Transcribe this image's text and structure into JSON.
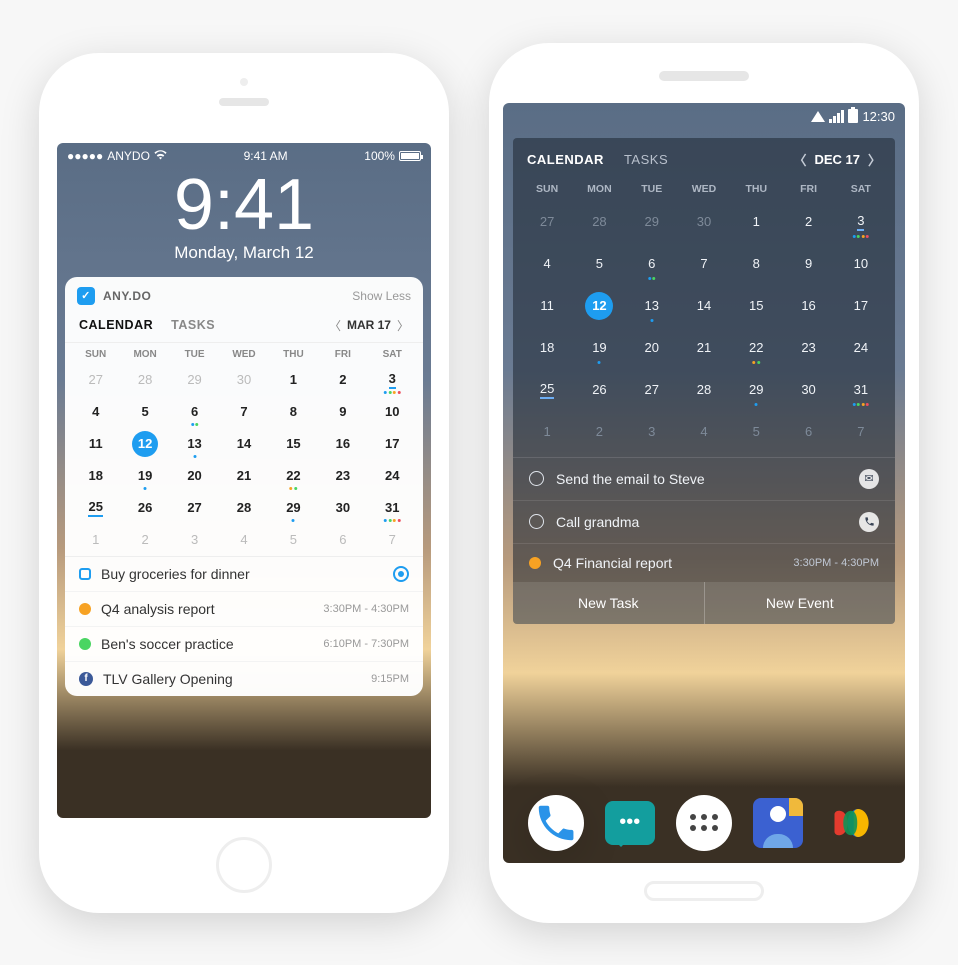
{
  "ios": {
    "status": {
      "carrier": "ANYDO",
      "time": "9:41 AM",
      "battery": "100%"
    },
    "lock": {
      "time": "9:41",
      "date": "Monday, March 12"
    },
    "widget": {
      "brand": "ANY.DO",
      "showless": "Show Less",
      "tabs": {
        "calendar": "CALENDAR",
        "tasks": "TASKS"
      },
      "nav_label": "MAR 17",
      "dow": [
        "SUN",
        "MON",
        "TUE",
        "WED",
        "THU",
        "FRI",
        "SAT"
      ],
      "weeks": [
        [
          {
            "n": "27",
            "fade": true
          },
          {
            "n": "28",
            "fade": true
          },
          {
            "n": "29",
            "fade": true
          },
          {
            "n": "30",
            "fade": true
          },
          {
            "n": "1"
          },
          {
            "n": "2"
          },
          {
            "n": "3",
            "ul": true,
            "dots": [
              "b",
              "g",
              "o",
              "r"
            ]
          }
        ],
        [
          {
            "n": "4"
          },
          {
            "n": "5"
          },
          {
            "n": "6",
            "dots": [
              "b",
              "g"
            ]
          },
          {
            "n": "7"
          },
          {
            "n": "8"
          },
          {
            "n": "9"
          },
          {
            "n": "10"
          }
        ],
        [
          {
            "n": "11"
          },
          {
            "n": "12",
            "sel": true
          },
          {
            "n": "13",
            "dots": [
              "b"
            ]
          },
          {
            "n": "14"
          },
          {
            "n": "15"
          },
          {
            "n": "16"
          },
          {
            "n": "17"
          }
        ],
        [
          {
            "n": "18"
          },
          {
            "n": "19",
            "dots": [
              "b"
            ]
          },
          {
            "n": "20"
          },
          {
            "n": "21"
          },
          {
            "n": "22",
            "dots": [
              "o",
              "g"
            ]
          },
          {
            "n": "23"
          },
          {
            "n": "24"
          }
        ],
        [
          {
            "n": "25",
            "ul": true
          },
          {
            "n": "26"
          },
          {
            "n": "27"
          },
          {
            "n": "28"
          },
          {
            "n": "29",
            "dots": [
              "b"
            ]
          },
          {
            "n": "30"
          },
          {
            "n": "31",
            "dots": [
              "b",
              "g",
              "o",
              "r"
            ]
          }
        ],
        [
          {
            "n": "1",
            "fade": true
          },
          {
            "n": "2",
            "fade": true
          },
          {
            "n": "3",
            "fade": true
          },
          {
            "n": "4",
            "fade": true
          },
          {
            "n": "5",
            "fade": true
          },
          {
            "n": "6",
            "fade": true
          },
          {
            "n": "7",
            "fade": true
          }
        ]
      ],
      "tasks": [
        {
          "kind": "todo",
          "label": "Buy groceries for dinner"
        },
        {
          "kind": "event",
          "color": "#f7a223",
          "label": "Q4 analysis report",
          "time": "3:30PM - 4:30PM"
        },
        {
          "kind": "event",
          "color": "#4ad562",
          "label": "Ben's soccer practice",
          "time": "6:10PM - 7:30PM"
        },
        {
          "kind": "fb",
          "label": "TLV Gallery Opening",
          "time": "9:15PM"
        }
      ]
    }
  },
  "android": {
    "status": {
      "time": "12:30"
    },
    "widget": {
      "tabs": {
        "calendar": "CALENDAR",
        "tasks": "TASKS"
      },
      "nav_label": "DEC 17",
      "dow": [
        "SUN",
        "MON",
        "TUE",
        "WED",
        "THU",
        "FRI",
        "SAT"
      ],
      "weeks": [
        [
          {
            "n": "27",
            "fade": true
          },
          {
            "n": "28",
            "fade": true
          },
          {
            "n": "29",
            "fade": true
          },
          {
            "n": "30",
            "fade": true
          },
          {
            "n": "1"
          },
          {
            "n": "2"
          },
          {
            "n": "3",
            "ul": true,
            "dots": [
              "b",
              "g",
              "o",
              "r"
            ]
          }
        ],
        [
          {
            "n": "4"
          },
          {
            "n": "5"
          },
          {
            "n": "6",
            "dots": [
              "b",
              "g"
            ]
          },
          {
            "n": "7"
          },
          {
            "n": "8"
          },
          {
            "n": "9"
          },
          {
            "n": "10"
          }
        ],
        [
          {
            "n": "11"
          },
          {
            "n": "12",
            "sel": true
          },
          {
            "n": "13",
            "dots": [
              "b"
            ]
          },
          {
            "n": "14"
          },
          {
            "n": "15"
          },
          {
            "n": "16"
          },
          {
            "n": "17"
          }
        ],
        [
          {
            "n": "18"
          },
          {
            "n": "19",
            "dots": [
              "b"
            ]
          },
          {
            "n": "20"
          },
          {
            "n": "21"
          },
          {
            "n": "22",
            "dots": [
              "o",
              "g"
            ]
          },
          {
            "n": "23"
          },
          {
            "n": "24"
          }
        ],
        [
          {
            "n": "25",
            "ul": true
          },
          {
            "n": "26"
          },
          {
            "n": "27"
          },
          {
            "n": "28"
          },
          {
            "n": "29",
            "dots": [
              "b"
            ]
          },
          {
            "n": "30"
          },
          {
            "n": "31",
            "dots": [
              "b",
              "g",
              "o",
              "r"
            ]
          }
        ],
        [
          {
            "n": "1",
            "fade": true
          },
          {
            "n": "2",
            "fade": true
          },
          {
            "n": "3",
            "fade": true
          },
          {
            "n": "4",
            "fade": true
          },
          {
            "n": "5",
            "fade": true
          },
          {
            "n": "6",
            "fade": true
          },
          {
            "n": "7",
            "fade": true
          }
        ]
      ],
      "items": [
        {
          "kind": "task",
          "label": "Send the email to Steve",
          "badge": "mail"
        },
        {
          "kind": "task",
          "label": "Call grandma",
          "badge": "phone"
        },
        {
          "kind": "event",
          "label": "Q4 Financial report",
          "time": "3:30PM - 4:30PM"
        }
      ],
      "actions": {
        "new_task": "New Task",
        "new_event": "New Event"
      }
    }
  }
}
